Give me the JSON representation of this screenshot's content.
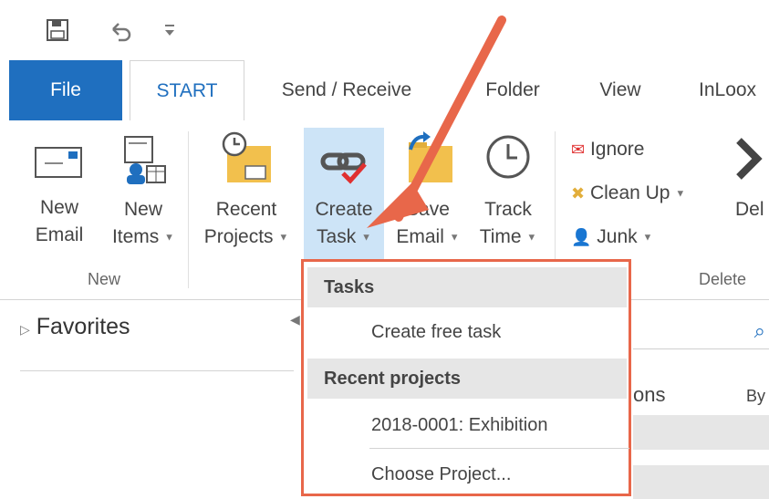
{
  "tabs": [
    "File",
    "START",
    "Send / Receive",
    "Folder",
    "View",
    "InLoox"
  ],
  "ribbon": {
    "new_email": [
      "New",
      "Email"
    ],
    "new_items": [
      "New",
      "Items"
    ],
    "recent_projects": [
      "Recent",
      "Projects"
    ],
    "create_task": [
      "Create",
      "Task"
    ],
    "save_email": [
      "Save",
      "Email"
    ],
    "track_time": [
      "Track",
      "Time"
    ],
    "ignore": "Ignore",
    "clean_up": "Clean Up",
    "junk": "Junk",
    "delete_partial": "Del",
    "group_new": "New",
    "group_delete": "Delete"
  },
  "nav": {
    "favorites": "Favorites"
  },
  "background_partial": {
    "ons": "ons",
    "by": "By"
  },
  "dropdown": {
    "tasks_header": "Tasks",
    "create_free_task": "Create free task",
    "recent_header": "Recent projects",
    "recent_item": "2018-0001: Exhibition",
    "choose_project": "Choose Project..."
  },
  "colors": {
    "accent": "#1f6fbf",
    "annotation": "#e8674a",
    "highlight": "#cde4f7"
  }
}
